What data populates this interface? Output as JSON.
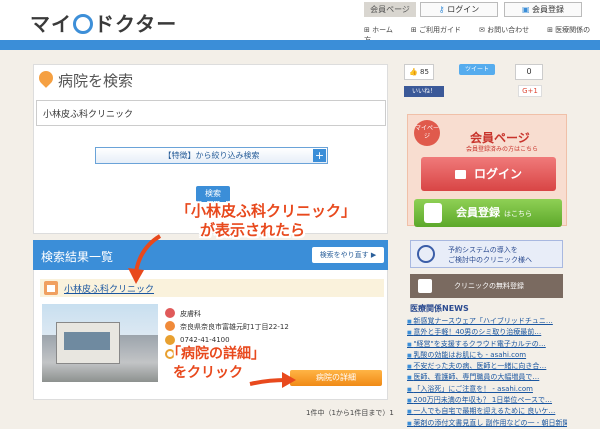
{
  "header": {
    "logo_prefix": "マイ",
    "logo_suffix": "ドクター",
    "member_page_label": "会員ページ",
    "login_label": "ログイン",
    "register_label": "会員登録",
    "nav": [
      "ホーム",
      "ご利用ガイド",
      "お問い合わせ",
      "医療関係の方"
    ]
  },
  "search": {
    "title": "病院を検索",
    "input_value": "小林皮ふ科クリニック",
    "filter_label": "【特徴】から絞り込み検索",
    "submit_label": "検索"
  },
  "results": {
    "title": "検索結果一覧",
    "redo_label": "検索をやり直す",
    "clinic_name": "小林皮ふ科クリニック",
    "department": "皮膚科",
    "address": "奈良県奈良市富雄元町1丁目22-12",
    "phone": "0742-41-4100",
    "detail_label": "病院の詳細",
    "page_info": "1件中（1から1件目まで）1"
  },
  "callouts": {
    "first_line1": "「小林皮ふ科クリニック」",
    "first_line2": "が表示されたら",
    "second_line1": "「病院の詳細」",
    "second_line2": "をクリック"
  },
  "social": {
    "fb_count": "85",
    "fb_label": "いいね！",
    "tweet_label": "ツイート",
    "gplus_count": "0",
    "gplus_label": "G+1"
  },
  "sidebar": {
    "member_badge": "マイページ",
    "member_title": "会員ページ",
    "member_sub": "会員登録済みの方はこちら",
    "login_label": "ログイン",
    "register_label": "会員登録",
    "register_sub": "はこちら",
    "reserve_line1": "予約システムの導入を",
    "reserve_line2": "ご検討中のクリニック様へ",
    "free_label": "クリニックの無料登録",
    "news_title": "医療関係NEWS",
    "news": [
      "新感覚ナースウェア「ハイブリッドチュニ…",
      "意外と手軽！40男のシミ取り治療最前…",
      "\"経営\"を支援するクラウド電子カルテの…",
      "乳酸の効能はお肌にも - asahi.com",
      "不安だった夫の病、医師と一緒に向き合…",
      "医師、看護師、専門職員の大幅増員で…",
      "「入浴死」にご注意を！ - asahi.com",
      "200万円未満の年収も？ 1日単位ペースで…",
      "一人でも自宅で最期を迎えるために 良いケ…",
      "薬剤の添付文書見直し 副作用などの一 - 朝日新聞"
    ]
  },
  "colors": {
    "brand_blue": "#3b8ed8",
    "callout_red": "#e8491d",
    "login_red": "#d84545",
    "register_green": "#5ca82a",
    "detail_orange": "#f08a16"
  }
}
